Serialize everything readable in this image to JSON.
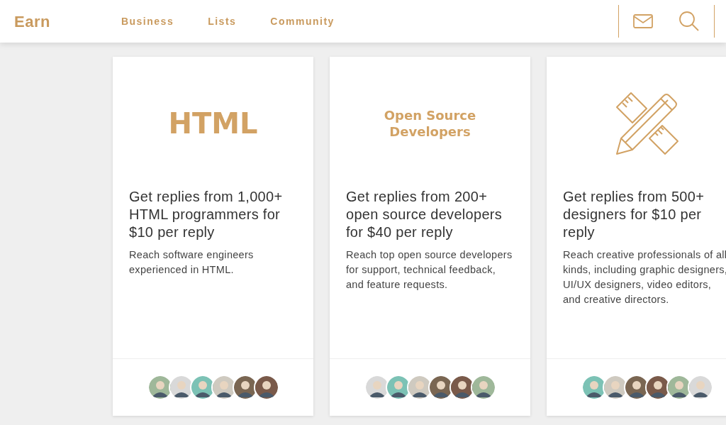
{
  "header": {
    "logo": "Earn",
    "nav": [
      "Business",
      "Lists",
      "Community"
    ]
  },
  "cards": [
    {
      "logo": {
        "kind": "text",
        "lines": [
          "HTML"
        ]
      },
      "title": "Get replies from 1,000+ HTML programmers for $10 per reply",
      "description": "Reach software engineers experienced in HTML."
    },
    {
      "logo": {
        "kind": "text",
        "lines": [
          "Open Source",
          "Developers"
        ]
      },
      "title": "Get replies from 200+ open source developers for $40 per reply",
      "description": "Reach top open source developers for support, technical feedback, and feature requests."
    },
    {
      "logo": {
        "kind": "icon"
      },
      "title": "Get replies from 500+ designers for $10 per reply",
      "description": "Reach creative professionals of all kinds, including graphic designers, UI/UX designers, video editors, and creative directors."
    }
  ]
}
